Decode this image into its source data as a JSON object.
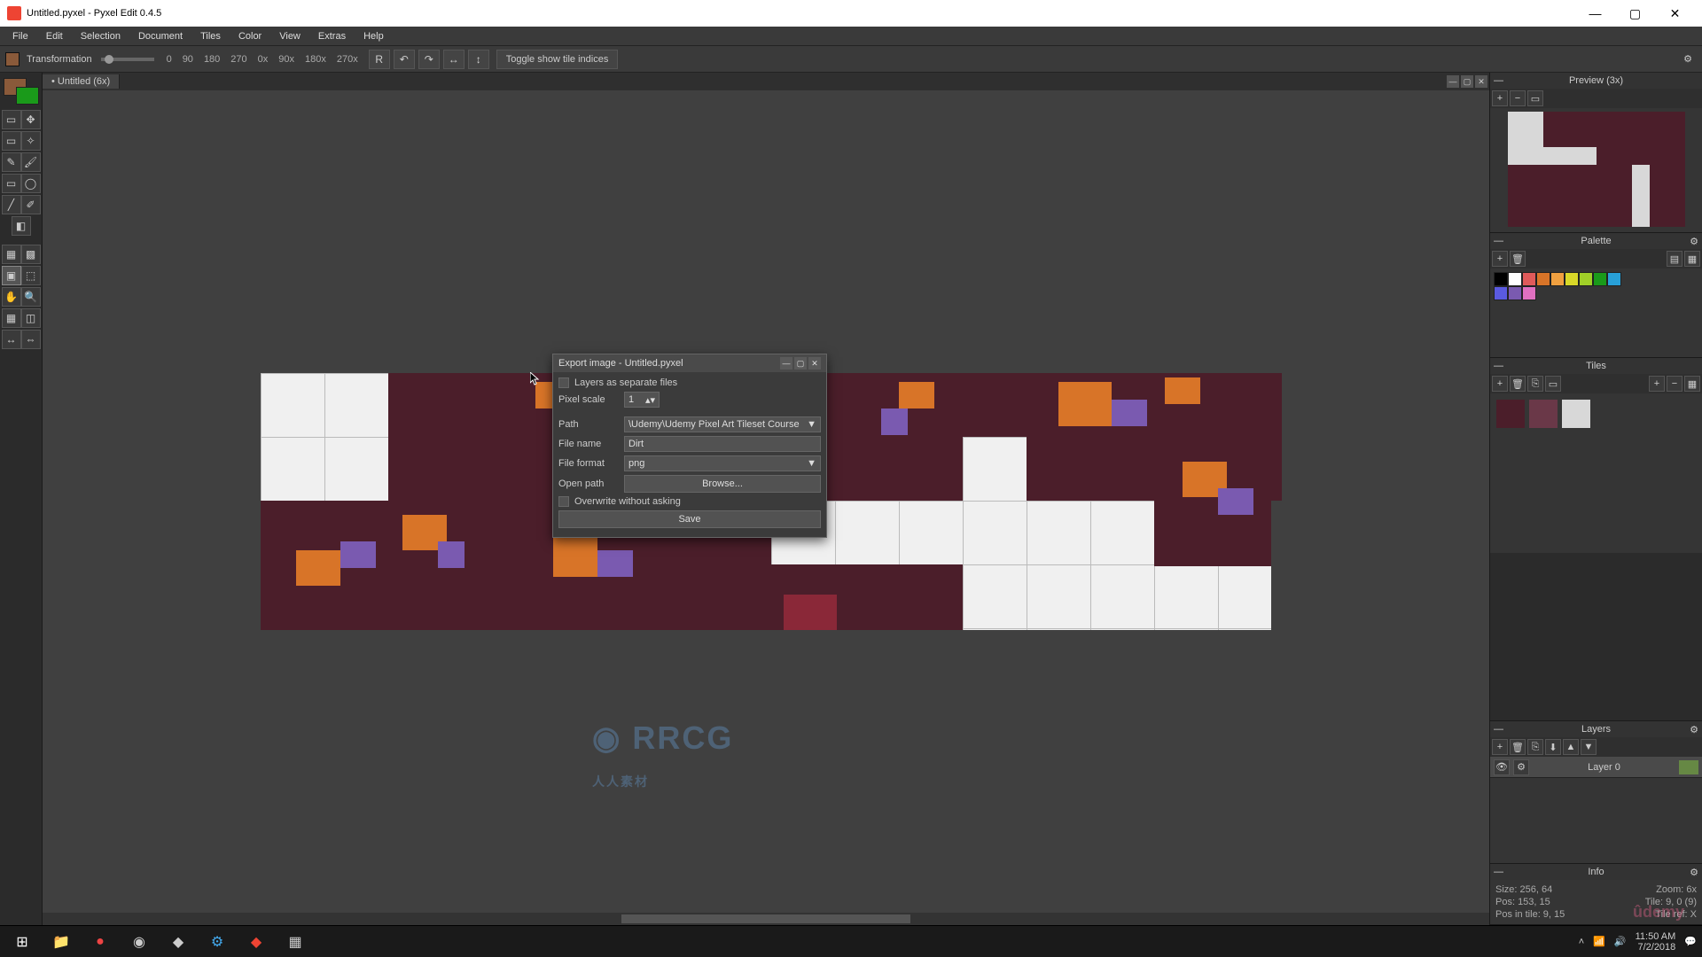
{
  "window": {
    "title": "Untitled.pyxel - Pyxel Edit 0.4.5",
    "buttons": {
      "min": "—",
      "max": "▢",
      "close": "✕"
    }
  },
  "menubar": [
    "File",
    "Edit",
    "Selection",
    "Document",
    "Tiles",
    "Color",
    "View",
    "Extras",
    "Help"
  ],
  "toolbar": {
    "label": "Transformation",
    "rotations": [
      "0",
      "90",
      "180",
      "270",
      "0x",
      "90x",
      "180x",
      "270x"
    ],
    "r_button": "R",
    "toggle": "Toggle show tile indices"
  },
  "doc": {
    "tab": "• Untitled   (6x)"
  },
  "dialog": {
    "title": "Export image - Untitled.pyxel",
    "layers_separate": "Layers as separate files",
    "pixel_scale_label": "Pixel scale",
    "pixel_scale_value": "1",
    "path_label": "Path",
    "path_value": "\\Udemy\\Udemy Pixel Art Tileset Course",
    "filename_label": "File name",
    "filename_value": "Dirt",
    "format_label": "File format",
    "format_value": "png",
    "openpath_label": "Open path",
    "browse": "Browse...",
    "overwrite": "Overwrite without asking",
    "save": "Save"
  },
  "panels": {
    "preview": "Preview (3x)",
    "palette": "Palette",
    "tiles": "Tiles",
    "layers": "Layers",
    "info": "Info"
  },
  "palette_colors": [
    "#000000",
    "#ffffff",
    "#e05a5a",
    "#d87428",
    "#f0a040",
    "#d8d828",
    "#a0d028",
    "#1a9a1a",
    "#28a0d8",
    "#5a5ae0",
    "#7a5ab0",
    "#e070c0"
  ],
  "layer": {
    "name": "Layer 0"
  },
  "info": {
    "size_l": "Size: 256, 64",
    "zoom": "Zoom: 6x",
    "pos": "Pos: 153, 15",
    "tile": "Tile: 9, 0 (9)",
    "posintile": "Pos in tile: 9, 15",
    "tileref": "Tile ref: X"
  },
  "taskbar": {
    "time": "11:50 AM",
    "date": "7/2/2018"
  }
}
